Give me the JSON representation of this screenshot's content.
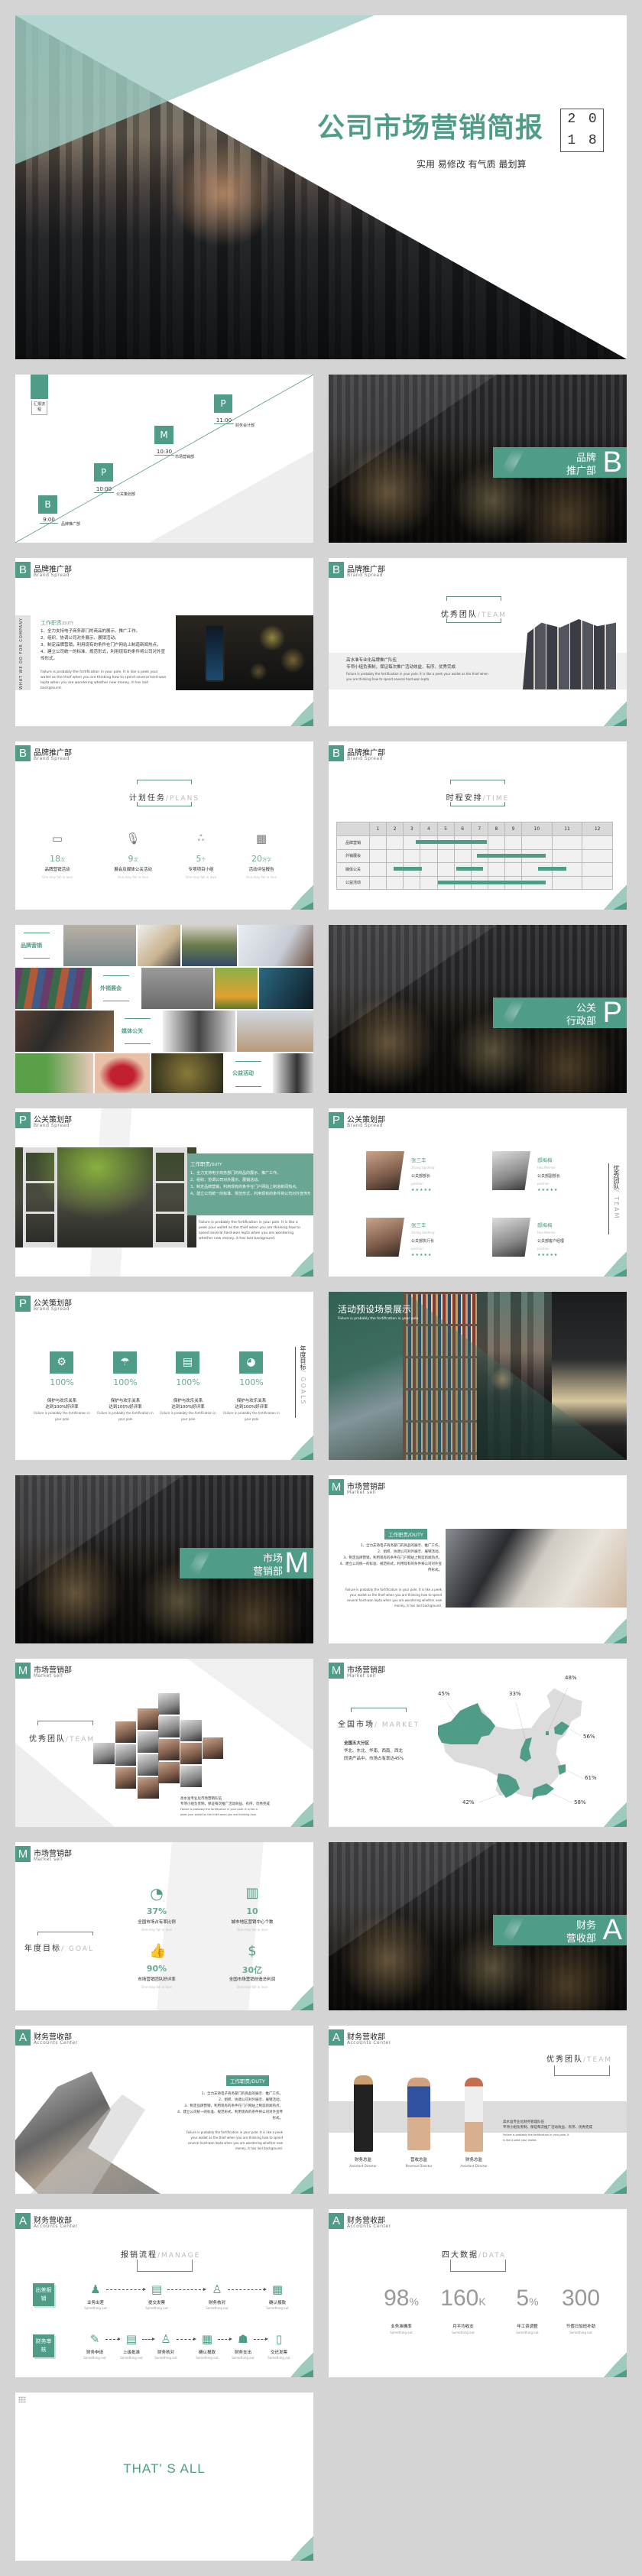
{
  "accent": "#4f9c88",
  "cover": {
    "title": "公司市场营销简报",
    "subtitle": "实用 易修改 有气质 最划算",
    "year": [
      "2",
      "0",
      "1",
      "8"
    ]
  },
  "sections": {
    "B": {
      "letter": "B",
      "title": "品牌推广部",
      "subtitle": "Brand Spread",
      "cover": [
        "品牌",
        "推广部"
      ]
    },
    "P": {
      "letter": "P",
      "title": "公关策划部",
      "subtitle": "Brand Spread",
      "cover": [
        "公关",
        "行政部"
      ]
    },
    "M": {
      "letter": "M",
      "title": "市场营销部",
      "subtitle": "Market sell",
      "cover": [
        "市场",
        "营销部"
      ]
    },
    "A": {
      "letter": "A",
      "title": "财务营收部",
      "subtitle": "AccoUnts Center",
      "cover": [
        "财务",
        "营收部"
      ]
    }
  },
  "agenda": {
    "label": "汇报流程",
    "steps": [
      {
        "letter": "B",
        "time": "9:00",
        "dept": "品牌推广部"
      },
      {
        "letter": "P",
        "time": "10:00",
        "dept": "公关策划部"
      },
      {
        "letter": "M",
        "time": "10:30",
        "dept": "市场营销部"
      },
      {
        "letter": "P",
        "time": "11:00",
        "dept": "财务会计部"
      }
    ]
  },
  "duty": {
    "title": "工作职责",
    "title_en": "/DUTY",
    "side": "WHAT WE DO FOR COMPANY",
    "items": [
      "1、全力支持电子商务部门的商品的展示、推广工作。",
      "2、组织、协调公司对外展示、展销活动。",
      "3、制定品牌营销，利用现有的条件在门户网站上制造新闻热点。",
      "4、建立公司统一的标准、规范形式，利用现有的条件将公司对外宣传形式。"
    ],
    "en": "Failure is probably the fortification in your pole. It is like a peek your wallet as the thief when you are thinking how to spend several hard-won lepta when you are wondering whether new money, it has laid background."
  },
  "team_b": {
    "title": "优秀团队",
    "title_en": "/TEAM",
    "line1": "高水准专业化品牌推广队伍",
    "line2": "专项小组负责制，保证每次推广活动效益、有序、优秀完成",
    "en": "Failure is probably the fortification in your pole. It is like a peek your wallet as the thief when you are thinking how to spend several hard-won lepta"
  },
  "plans": {
    "title": "计划任务",
    "title_en": "/PLANS",
    "items": [
      {
        "icon": "monitor-icon",
        "num": "18",
        "unit": "次",
        "label": "品牌营销活动",
        "sub": "One may fall in love"
      },
      {
        "icon": "microphone-icon",
        "num": "9",
        "unit": "次",
        "label": "展会及媒体公关活动",
        "sub": "One may fall in love"
      },
      {
        "icon": "team-icon",
        "num": "5",
        "unit": "个",
        "label": "专项项目小组",
        "sub": "One may fall in love"
      },
      {
        "icon": "report-icon",
        "num": "20",
        "unit": "万字",
        "label": "活动评估报告",
        "sub": "One may fall in love"
      }
    ]
  },
  "schedule": {
    "title": "时程安排",
    "title_en": "/TIME",
    "months": [
      "1",
      "2",
      "3",
      "4",
      "5",
      "6",
      "7",
      "8",
      "9",
      "10",
      "11",
      "12"
    ],
    "rows": [
      {
        "name": "品牌营销",
        "spans": [
          [
            3.3,
            6.8
          ]
        ]
      },
      {
        "name": "外销展会",
        "spans": [
          [
            6.3,
            9.7
          ]
        ]
      },
      {
        "name": "媒体公关",
        "spans": [
          [
            2.2,
            3.6
          ],
          [
            5.3,
            6.6
          ],
          [
            9.3,
            10.7
          ]
        ]
      },
      {
        "name": "公益活动",
        "spans": [
          [
            4.4,
            9.7
          ]
        ]
      }
    ]
  },
  "collage": {
    "labels": [
      "品牌营销",
      "外销展会",
      "媒体公关",
      "公益活动"
    ]
  },
  "team_p": {
    "title": "优秀团队",
    "title_en": "/ TEAM",
    "members": [
      {
        "name": "张三丰",
        "en": "Zhang Sanfeng",
        "role": "公关部部长",
        "role_en": "position",
        "stars": "★★★★★"
      },
      {
        "name": "郝梅梅",
        "en": "Hao Meimei",
        "role": "公关部副部长",
        "role_en": "position",
        "stars": "★★★★★"
      },
      {
        "name": "张三丰",
        "en": "Zhang Sanfeng",
        "role": "公关部执行长",
        "role_en": "position",
        "stars": "★★★★★"
      },
      {
        "name": "郝梅梅",
        "en": "Hao Meimei",
        "role": "公关部客户经理",
        "role_en": "position",
        "stars": "★★★★★"
      }
    ]
  },
  "goals_p": {
    "title": "年度目标",
    "title_en": "/ GOALS",
    "items": [
      {
        "icon": "gear-icon",
        "pct": "100%",
        "l1": "保护与欢乐关系",
        "l2": "达到100%好评率",
        "sub": "Failure is probably the fortification in your pole"
      },
      {
        "icon": "umbrella-icon",
        "pct": "100%",
        "l1": "保护与欢乐关系",
        "l2": "达到100%好评率",
        "sub": "Failure is probably the fortification in your pole"
      },
      {
        "icon": "card-icon",
        "pct": "100%",
        "l1": "保护与欢乐关系",
        "l2": "达到100%好评率",
        "sub": "Failure is probably the fortification in your pole"
      },
      {
        "icon": "pie-icon",
        "pct": "100%",
        "l1": "保护与欢乐关系",
        "l2": "达到100%好评率",
        "sub": "Failure is probably the fortification in your pole"
      }
    ]
  },
  "scenes": {
    "title": "活动预设场景展示",
    "sub": "Failure is probably the fortification in your pole"
  },
  "team_m": {
    "title": "优秀团队",
    "title_en": "/TEAM",
    "line1": "高水准专业化市场营销队伍",
    "line2": "专项小组负责制，保证每次推广活动效益、有序、优秀完成",
    "en": "Failure is probably the fortification in your pole. It is like a peek your wallet as the thief when you are thinking how."
  },
  "market": {
    "title": "全国市场",
    "title_en": "/ MARKET",
    "h": "全国五大分区",
    "l1": "华北、东北、华南、西南、西北",
    "l2": "同类产品中，市场占有率达45%",
    "labels": [
      "45%",
      "33%",
      "48%",
      "56%",
      "61%",
      "58%",
      "42%"
    ]
  },
  "goal_m": {
    "title": "年度目标",
    "title_en": "/ GOAL",
    "items": [
      {
        "icon": "pie-icon",
        "num": "37%",
        "label": "全国市场占有率比例",
        "sub": "One may fall in love"
      },
      {
        "icon": "building-icon",
        "num": "10",
        "label": "城市地区营销中心个数",
        "sub": "One may fall in love"
      },
      {
        "icon": "thumbs-up-icon",
        "num": "90%",
        "label": "市场营销团队好评率",
        "sub": "One may fall in love"
      },
      {
        "icon": "money-bag-icon",
        "num": "30亿",
        "label": "全国市场营销创造总利润",
        "sub": "One may fall in love"
      }
    ]
  },
  "team_a": {
    "title": "优秀团队",
    "title_en": "/TEAM",
    "line1": "高水准专业化财务管理队伍",
    "line2": "专项小组负责制，保证每次推广活动效益、有序、优秀完成",
    "en": "Failure is probably the fortification in your pole. It is like a peek your wallet.",
    "members": [
      {
        "role": "财务总监",
        "en": "Assistant Director"
      },
      {
        "role": "营收总监",
        "en": "Revenue Director"
      },
      {
        "role": "财务总监",
        "en": "Assistant Director"
      }
    ]
  },
  "manage": {
    "title": "报销流程",
    "title_en": "/MANAGE",
    "row1": {
      "label": "出差报销",
      "steps": [
        "业务出差",
        "提交发票",
        "财务核对",
        "确认报款"
      ]
    },
    "row2": {
      "label": "财务审核",
      "steps": [
        "财务申请",
        "上级批准",
        "财务核对",
        "确认报款",
        "财务支出",
        "交还发票"
      ]
    },
    "sub": "Something out"
  },
  "data4": {
    "title": "四大数据",
    "title_en": "/DATA",
    "items": [
      {
        "num": "98",
        "unit": "%",
        "label": "业务准确率",
        "sub": "Something out"
      },
      {
        "num": "160",
        "unit": "K",
        "label": "月平均收支",
        "sub": "Something out"
      },
      {
        "num": "5",
        "unit": "%",
        "label": "年工资调整",
        "sub": "Something out"
      },
      {
        "num": "300",
        "unit": "",
        "label": "节假日加班补助",
        "sub": "Something out"
      }
    ]
  },
  "end": {
    "text": "THAT' S ALL"
  }
}
